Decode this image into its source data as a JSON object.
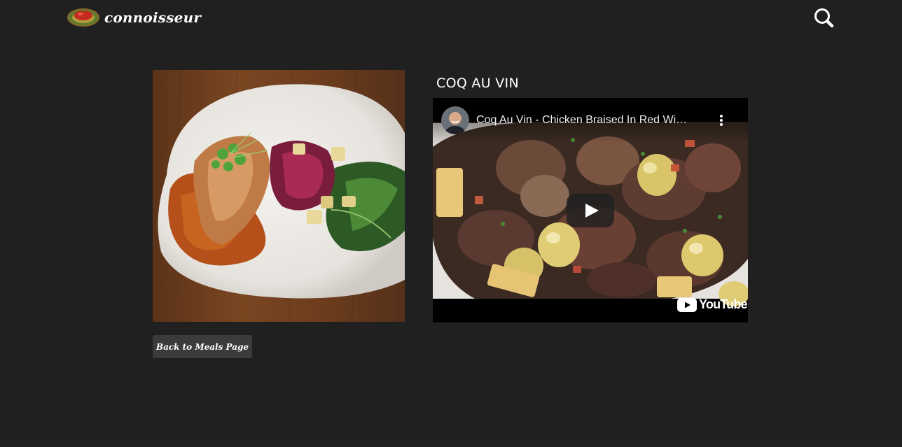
{
  "brand": {
    "name": "connoisseur"
  },
  "header": {
    "search_icon": "search-icon"
  },
  "meal": {
    "title": "COQ AU VIN",
    "image_alt": "plated-chicken-dish"
  },
  "video": {
    "title": "Coq Au Vin - Chicken Braised In Red Wi…",
    "platform": "YouTube",
    "icons": [
      "channel-avatar",
      "more-options-icon",
      "play-icon",
      "youtube-logo-icon"
    ]
  },
  "actions": {
    "back_label": "Back to Meals Page"
  },
  "colors": {
    "background": "#202020",
    "button": "#3b3b3b",
    "text": "#ffffff",
    "logo_red": "#c42b1e"
  }
}
